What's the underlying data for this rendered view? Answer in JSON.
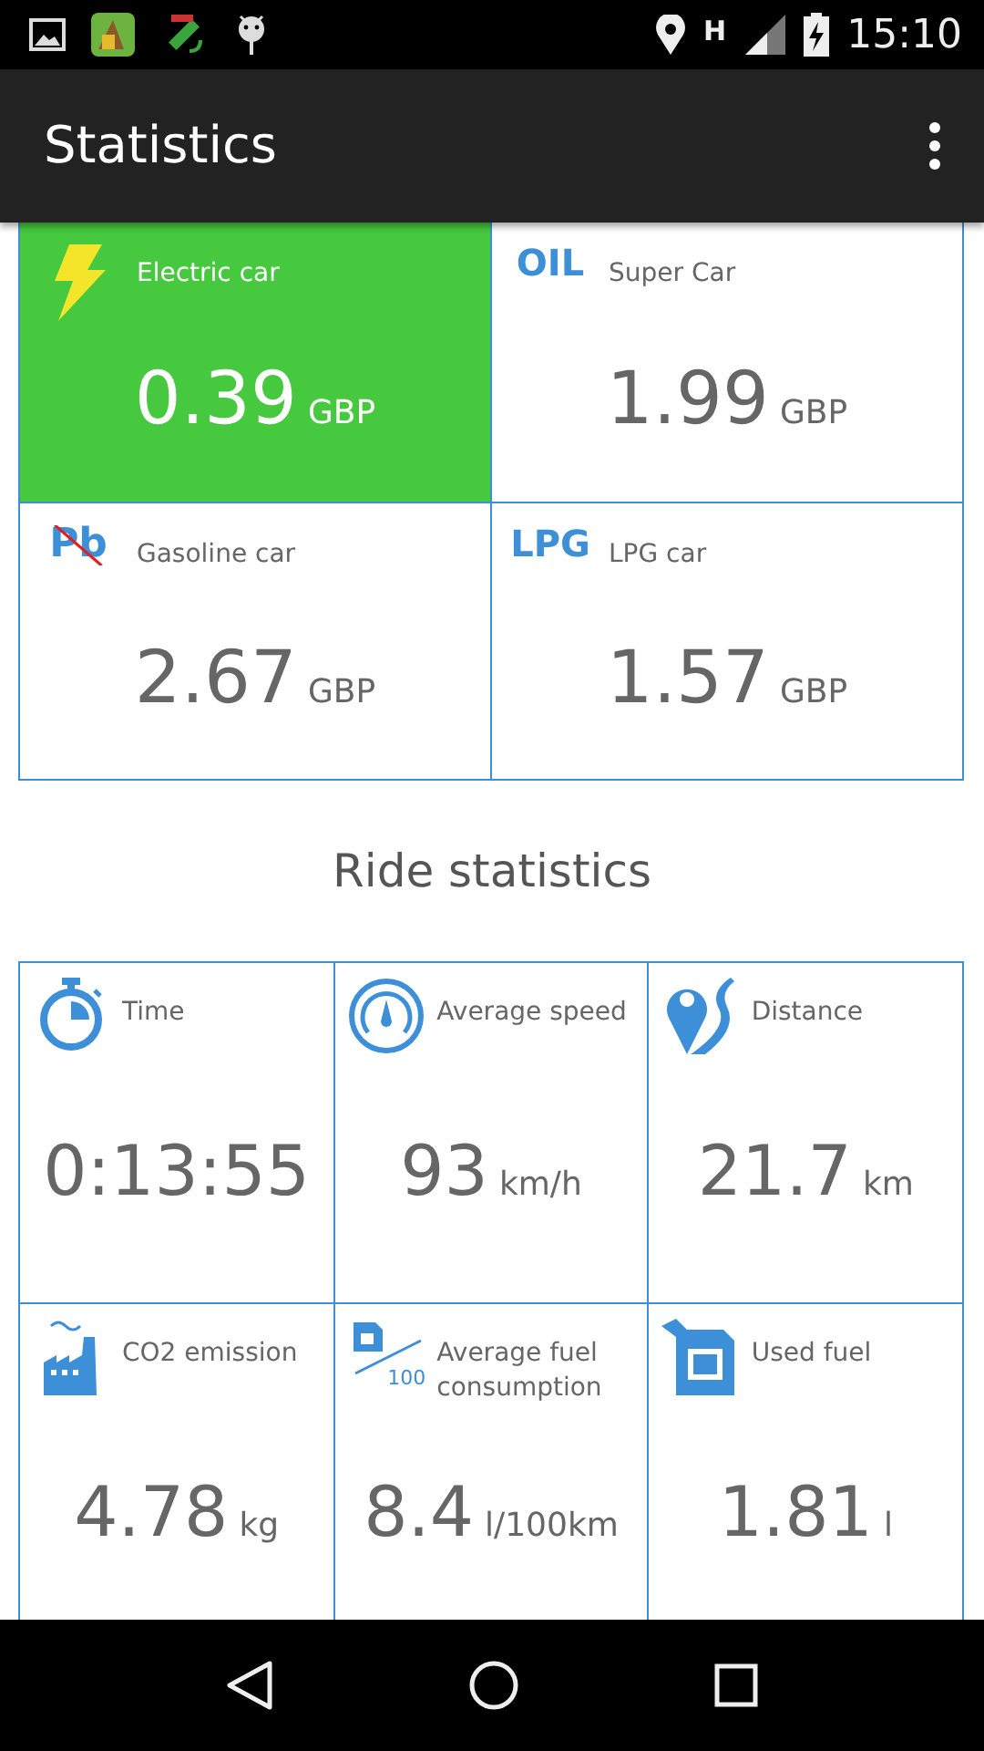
{
  "status_bar": {
    "network": "H",
    "time": "15:10"
  },
  "app_bar": {
    "title": "Statistics"
  },
  "fuel_cards": [
    {
      "kind": "bolt",
      "label": "Electric car",
      "value": "0.39",
      "unit": "GBP",
      "selected": true
    },
    {
      "kind": "text",
      "icon_text": "OIL",
      "label": "Super Car",
      "value": "1.99",
      "unit": "GBP",
      "selected": false
    },
    {
      "kind": "struck",
      "icon_text": "Pb",
      "label": "Gasoline car",
      "value": "2.67",
      "unit": "GBP",
      "selected": false
    },
    {
      "kind": "text",
      "icon_text": "LPG",
      "label": "LPG car",
      "value": "1.57",
      "unit": "GBP",
      "selected": false
    }
  ],
  "ride_statistics": {
    "title": "Ride statistics",
    "items": [
      {
        "kind": "stopwatch",
        "label": "Time",
        "value": "0:13:55"
      },
      {
        "kind": "gauge",
        "label": "Average speed",
        "value": "93",
        "unit": "km/h"
      },
      {
        "kind": "route",
        "label": "Distance",
        "value": "21.7",
        "unit": "km"
      },
      {
        "kind": "factory",
        "label": "CO2 emission",
        "value": "4.78",
        "unit": "kg"
      },
      {
        "kind": "per100",
        "icon_text": "100",
        "label": "Average fuel consumption",
        "value": "8.4",
        "unit": "l/100km"
      },
      {
        "kind": "can",
        "label": "Used fuel",
        "value": "1.81",
        "unit": "l"
      }
    ]
  }
}
